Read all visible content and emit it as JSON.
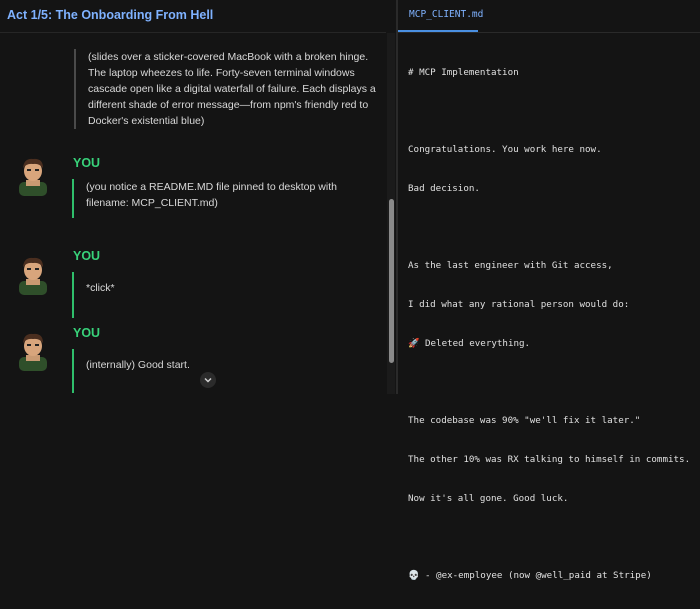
{
  "left_panel": {
    "act_title": "Act 1/5: The Onboarding From Hell",
    "narration": "(slides over a sticker-covered MacBook with a broken hinge. The laptop wheezes to life. Forty-seven terminal windows cascade open like a digital waterfall of failure. Each displays a different shade of error message—from npm's friendly red to Docker's existential blue)",
    "messages": [
      {
        "speaker": "YOU",
        "text": "(you notice a README.MD file pinned to desktop with filename: MCP_CLIENT.md)"
      },
      {
        "speaker": "YOU",
        "text": "*click*"
      },
      {
        "speaker": "YOU",
        "text": "(internally) Good start."
      }
    ]
  },
  "right_panel": {
    "tab_label": "MCP_CLIENT.md",
    "lines": {
      "l1": "# MCP Implementation",
      "l2": "Congratulations. You work here now.",
      "l3": "Bad decision.",
      "l4": "As the last engineer with Git access,",
      "l5": "I did what any rational person would do:",
      "l6": "🚀 Deleted everything.",
      "l7": "The codebase was 90% \"we'll fix it later.\"",
      "l8": "The other 10% was RX talking to himself in commits.",
      "l9": "Now it's all gone. Good luck.",
      "l10": "💀 - @ex-employee (now @well_paid at Stripe)"
    }
  },
  "colors": {
    "accent_blue": "#7fb2ff",
    "speaker_green": "#38d27a",
    "bar_green": "#2fbe6b",
    "background": "#141414"
  },
  "icons": {
    "avatar": "avatar-icon",
    "scroll_down": "chevron-down-icon"
  }
}
